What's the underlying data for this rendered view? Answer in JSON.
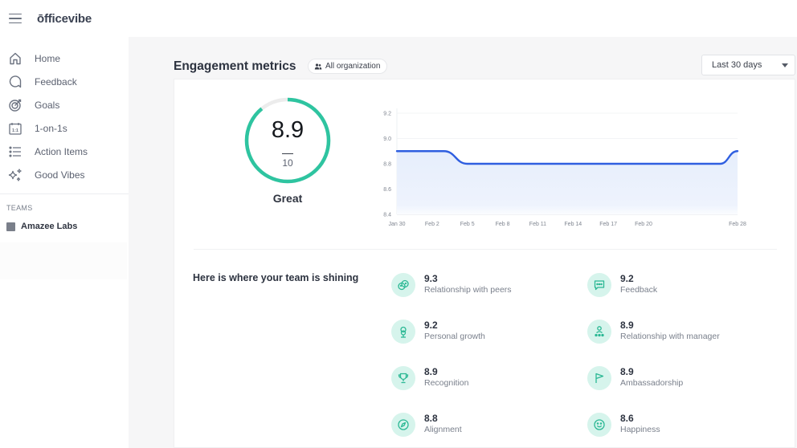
{
  "app": {
    "logo": "ōfficevibe"
  },
  "sidebar": {
    "items": [
      {
        "label": "Home",
        "icon": "home-icon"
      },
      {
        "label": "Feedback",
        "icon": "feedback-icon"
      },
      {
        "label": "Goals",
        "icon": "target-icon"
      },
      {
        "label": "1-on-1s",
        "icon": "calendar-icon"
      },
      {
        "label": "Action Items",
        "icon": "list-icon"
      },
      {
        "label": "Good Vibes",
        "icon": "sparkles-icon"
      }
    ],
    "teams_label": "TEAMS",
    "teams": [
      {
        "name": "Amazee Labs"
      }
    ]
  },
  "header": {
    "title": "Engagement metrics",
    "scope_chip": "All organization",
    "range_select": {
      "value": "Last 30 days"
    }
  },
  "score": {
    "value": "8.9",
    "max": "10",
    "fraction": 0.89,
    "label": "Great",
    "color": "#2ec4a0"
  },
  "chart_data": {
    "type": "area",
    "title": "",
    "xlabel": "",
    "ylabel": "",
    "ylim": [
      8.4,
      9.2
    ],
    "y_ticks": [
      "9.2",
      "9.0",
      "8.8",
      "8.6",
      "8.4"
    ],
    "x_tick_labels": [
      "Jan 30",
      "Feb 2",
      "Feb 5",
      "Feb 8",
      "Feb 11",
      "Feb 14",
      "Feb 17",
      "Feb 20",
      "Feb 28"
    ],
    "x_tick_days": [
      0,
      3,
      6,
      9,
      12,
      15,
      18,
      21,
      29
    ],
    "series": [
      {
        "name": "Engagement",
        "color": "#2f5fe0",
        "points": [
          {
            "day": 0,
            "value": 8.9
          },
          {
            "day": 4,
            "value": 8.9
          },
          {
            "day": 6,
            "value": 8.8
          },
          {
            "day": 27.5,
            "value": 8.8
          },
          {
            "day": 29,
            "value": 8.9
          }
        ]
      }
    ]
  },
  "shining": {
    "title": "Here is where your team is shining",
    "metrics": [
      {
        "value": "9.3",
        "name": "Relationship with peers",
        "icon": "peers-icon"
      },
      {
        "value": "9.2",
        "name": "Feedback",
        "icon": "chat-icon"
      },
      {
        "value": "9.2",
        "name": "Personal growth",
        "icon": "growth-icon"
      },
      {
        "value": "8.9",
        "name": "Relationship with manager",
        "icon": "manager-icon"
      },
      {
        "value": "8.9",
        "name": "Recognition",
        "icon": "trophy-icon"
      },
      {
        "value": "8.9",
        "name": "Ambassadorship",
        "icon": "flag-icon"
      },
      {
        "value": "8.8",
        "name": "Alignment",
        "icon": "compass-icon"
      },
      {
        "value": "8.6",
        "name": "Happiness",
        "icon": "smile-icon"
      }
    ]
  }
}
